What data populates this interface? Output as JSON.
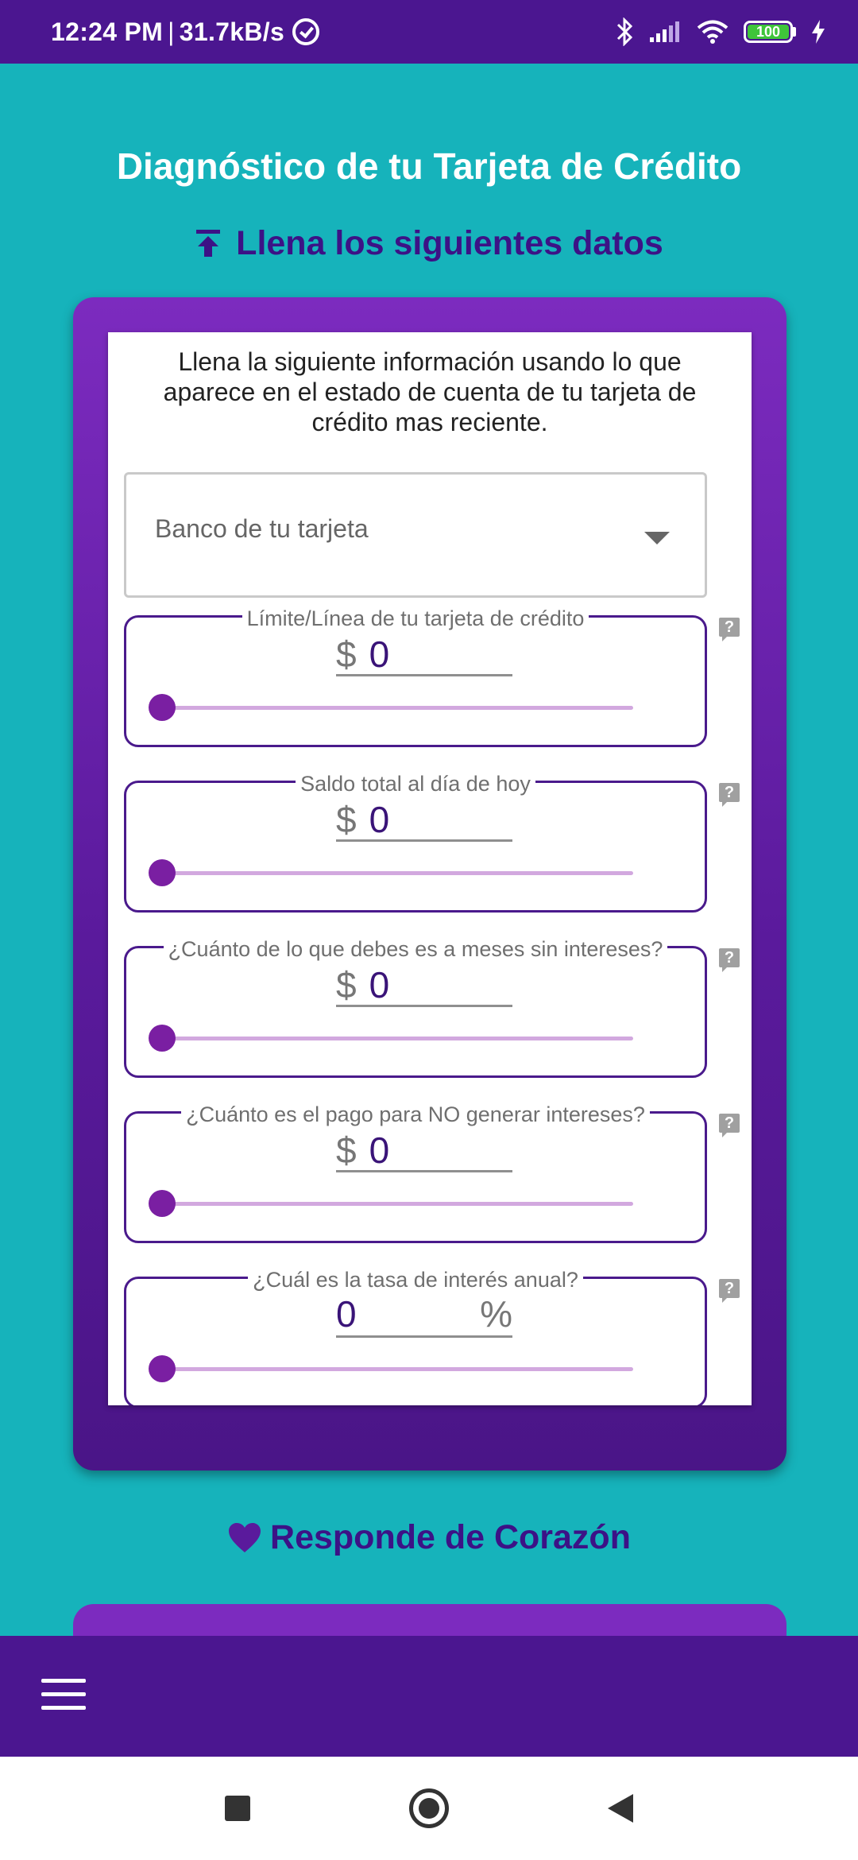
{
  "status_bar": {
    "time": "12:24 PM",
    "separator": "|",
    "network_speed": "31.7kB/s",
    "battery": "100",
    "icons": [
      "alarm-icon",
      "bluetooth-icon",
      "signal-icon",
      "wifi-icon",
      "battery-icon",
      "charging-icon"
    ]
  },
  "page": {
    "title": "Diagnóstico de tu Tarjeta de Crédito",
    "subtitle": "Llena los siguientes datos",
    "intro": "Llena la siguiente información usando lo que aparece en el estado de cuenta de tu tarjeta de crédito mas reciente."
  },
  "form": {
    "bank_select_label": "Banco de tu tarjeta",
    "fields": [
      {
        "label": "Límite/Línea de tu tarjeta de crédito",
        "currency": "$",
        "value": "0",
        "slider_value": 0
      },
      {
        "label": "Saldo total al día de hoy",
        "currency": "$",
        "value": "0",
        "slider_value": 0
      },
      {
        "label": "¿Cuánto de lo que debes es a meses sin intereses?",
        "currency": "$",
        "value": "0",
        "slider_value": 0
      },
      {
        "label": "¿Cuánto es el pago para NO generar intereses?",
        "currency": "$",
        "value": "0",
        "slider_value": 0
      },
      {
        "label": "¿Cuál es la tasa de interés anual?",
        "value": "0",
        "unit": "%",
        "slider_value": 0
      }
    ],
    "help_glyph": "?"
  },
  "section2": {
    "title": "Responde de Corazón"
  },
  "colors": {
    "teal_background": "#16b3bb",
    "purple_dark": "#4b1690",
    "purple_card": "#7c2bbf",
    "slider_thumb": "#7a1fa2",
    "slider_track": "#d2a8df"
  }
}
